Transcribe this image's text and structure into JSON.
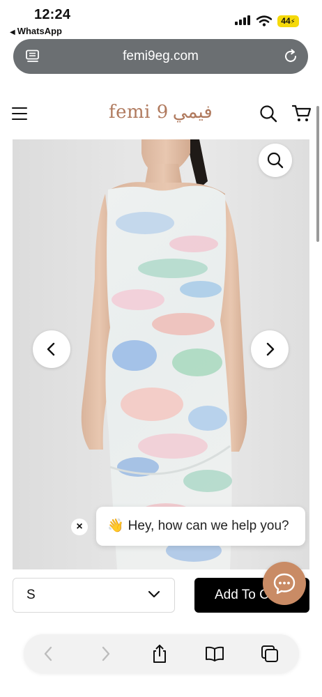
{
  "status_bar": {
    "time": "12:24",
    "back_app": "WhatsApp",
    "battery": "44"
  },
  "browser": {
    "url": "femi9eg.com"
  },
  "site": {
    "logo_latin": "femi 9",
    "logo_arabic": "فيمي"
  },
  "chat": {
    "wave_emoji": "👋",
    "message": "Hey, how can we help you?",
    "close_glyph": "×"
  },
  "product_bar": {
    "size_value": "S",
    "add_to_cart_label": "Add To Cart"
  },
  "colors": {
    "brand": "#b07a5e",
    "chat_fab": "#c98b65",
    "address_bar": "#6b6f72",
    "battery": "#f5d90a"
  },
  "icons": [
    "tabs-icon",
    "reload-icon",
    "menu-icon",
    "search-icon",
    "cart-icon",
    "zoom-icon",
    "chevron-left-icon",
    "chevron-right-icon",
    "close-icon",
    "chat-icon",
    "chevron-down-icon",
    "back-icon",
    "forward-icon",
    "share-icon",
    "bookmarks-icon",
    "tabs-overview-icon"
  ]
}
